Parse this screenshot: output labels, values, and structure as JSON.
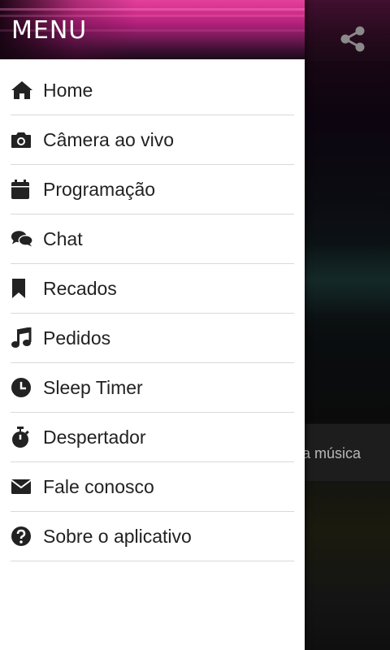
{
  "background": {
    "now_playing_text": "a música",
    "share_icon": "share-icon"
  },
  "drawer": {
    "title": "MENU",
    "items": [
      {
        "label": "Home",
        "icon": "home-icon"
      },
      {
        "label": "Câmera ao vivo",
        "icon": "camera-icon"
      },
      {
        "label": "Programação",
        "icon": "calendar-icon"
      },
      {
        "label": "Chat",
        "icon": "chat-icon"
      },
      {
        "label": "Recados",
        "icon": "bookmark-icon"
      },
      {
        "label": "Pedidos",
        "icon": "music-note-icon"
      },
      {
        "label": "Sleep Timer",
        "icon": "clock-icon"
      },
      {
        "label": "Despertador",
        "icon": "stopwatch-icon"
      },
      {
        "label": "Fale conosco",
        "icon": "envelope-icon"
      },
      {
        "label": "Sobre o aplicativo",
        "icon": "question-icon"
      }
    ]
  },
  "colors": {
    "icon": "#222222",
    "divider": "#d9d9d9",
    "header_accent": "#d12e8a"
  }
}
